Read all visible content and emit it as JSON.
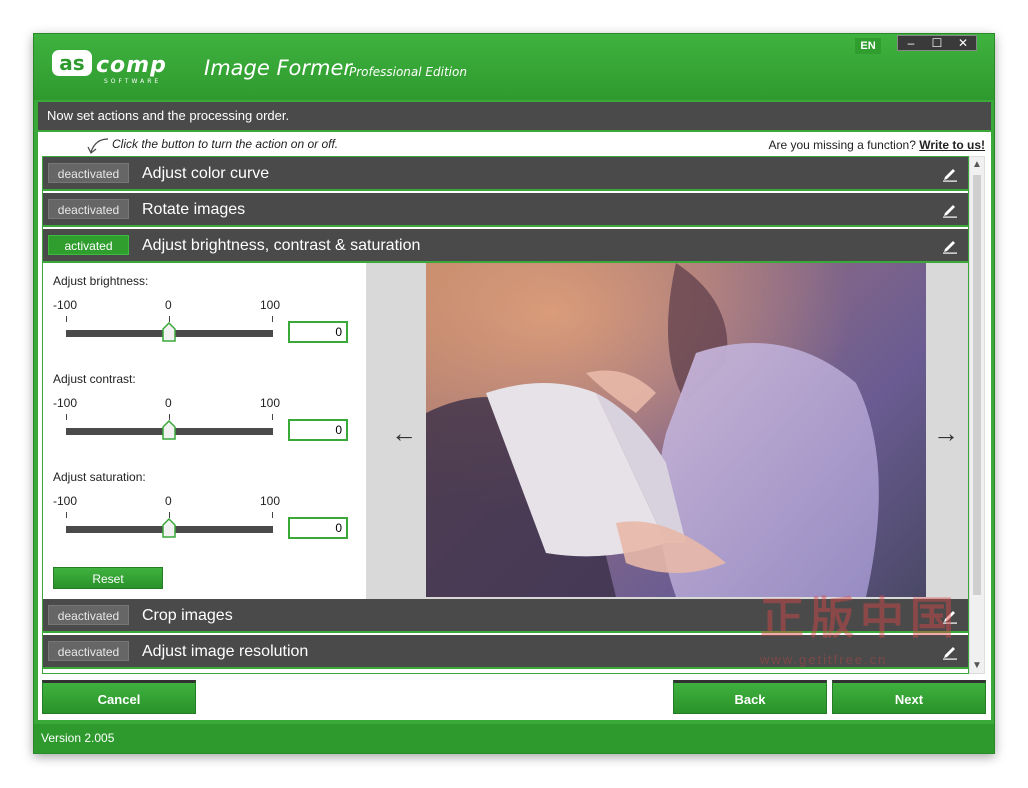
{
  "app": {
    "brand": "ascomp",
    "brand_sub": "SOFTWARE",
    "title": "Image Former",
    "edition": "Professional Edition",
    "language": "EN",
    "window_buttons": [
      "–",
      "☐",
      "✕"
    ]
  },
  "colors": {
    "accent": "#3aa93a",
    "dark_row": "#4a4a4a",
    "active_toggle": "#2f9e2f"
  },
  "instruction": "Now set actions and the processing order.",
  "hint": "Click the button to turn the action on or off.",
  "missing": {
    "text": "Are you missing a function?",
    "link": "Write to us!"
  },
  "actions": [
    {
      "state": "deactivated",
      "label": "Adjust color curve",
      "icon": "pencil-icon"
    },
    {
      "state": "deactivated",
      "label": "Rotate images",
      "icon": "pencil-icon"
    },
    {
      "state": "activated",
      "label": "Adjust brightness, contrast & saturation",
      "icon": "pencil-icon"
    },
    {
      "state": "deactivated",
      "label": "Crop images",
      "icon": "pencil-icon"
    },
    {
      "state": "deactivated",
      "label": "Adjust image resolution",
      "icon": "pencil-icon"
    }
  ],
  "sliders": [
    {
      "label": "Adjust brightness:",
      "min": "-100",
      "mid": "0",
      "max": "100",
      "value": "0",
      "min_value": -100,
      "max_value": 100
    },
    {
      "label": "Adjust contrast:",
      "min": "-100",
      "mid": "0",
      "max": "100",
      "value": "0",
      "min_value": -100,
      "max_value": 100
    },
    {
      "label": "Adjust saturation:",
      "min": "-100",
      "mid": "0",
      "max": "100",
      "value": "0",
      "min_value": -100,
      "max_value": 100
    }
  ],
  "reset_label": "Reset",
  "preview": {
    "prev_arrow": "←",
    "next_arrow": "→"
  },
  "buttons": {
    "cancel": "Cancel",
    "back": "Back",
    "next": "Next"
  },
  "watermark": {
    "main": "正版中国",
    "sub": "www.getitfree.cn"
  },
  "version": "Version 2.005"
}
